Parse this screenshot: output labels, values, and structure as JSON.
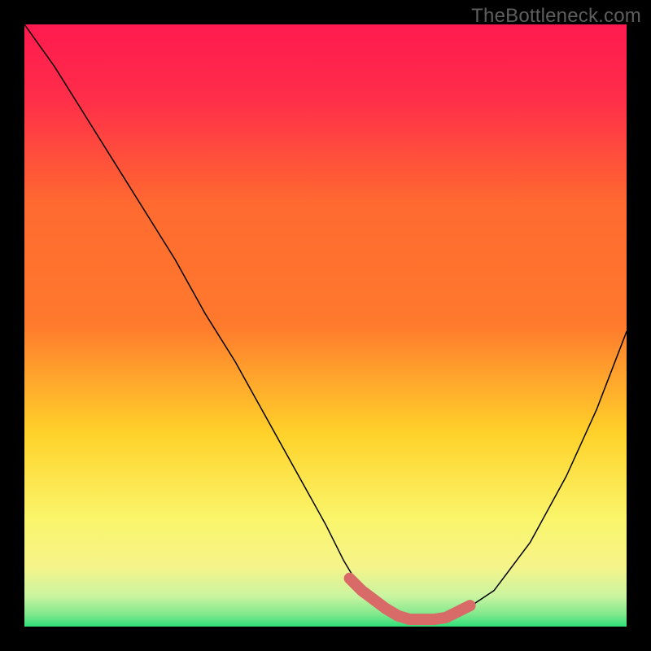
{
  "watermark": "TheBottleneck.com",
  "chart_data": {
    "type": "line",
    "title": "",
    "xlabel": "",
    "ylabel": "",
    "xlim": [
      0,
      100
    ],
    "ylim": [
      0,
      100
    ],
    "grid": false,
    "legend": null,
    "background_gradient": {
      "top": "#ff1a4f",
      "upper_mid": "#ff7a2d",
      "mid": "#ffd22a",
      "lower_mid": "#f6f48a",
      "bottom": "#2fe07a"
    },
    "series": [
      {
        "name": "bottleneck-curve",
        "color": "#000000",
        "stroke_width": 1.5,
        "x": [
          0,
          5,
          10,
          15,
          20,
          25,
          30,
          35,
          40,
          45,
          50,
          53,
          56,
          59,
          62,
          65,
          68,
          72,
          78,
          84,
          90,
          95,
          100
        ],
        "values": [
          100,
          93,
          85,
          77,
          69,
          61,
          52,
          44,
          35,
          26,
          17,
          11,
          6,
          3,
          1,
          1,
          1,
          2,
          6,
          14,
          25,
          36,
          49
        ]
      },
      {
        "name": "highlight-marker",
        "type": "scatter",
        "color": "#d86a68",
        "marker_radius_primary": 7,
        "marker_radius_secondary": 5,
        "x": [
          54,
          56,
          58,
          60,
          62,
          64,
          66,
          68,
          70,
          74
        ],
        "values": [
          8,
          6,
          4.5,
          3,
          1.8,
          1.2,
          1.2,
          1.2,
          1.5,
          3.5
        ]
      }
    ],
    "annotations": []
  }
}
